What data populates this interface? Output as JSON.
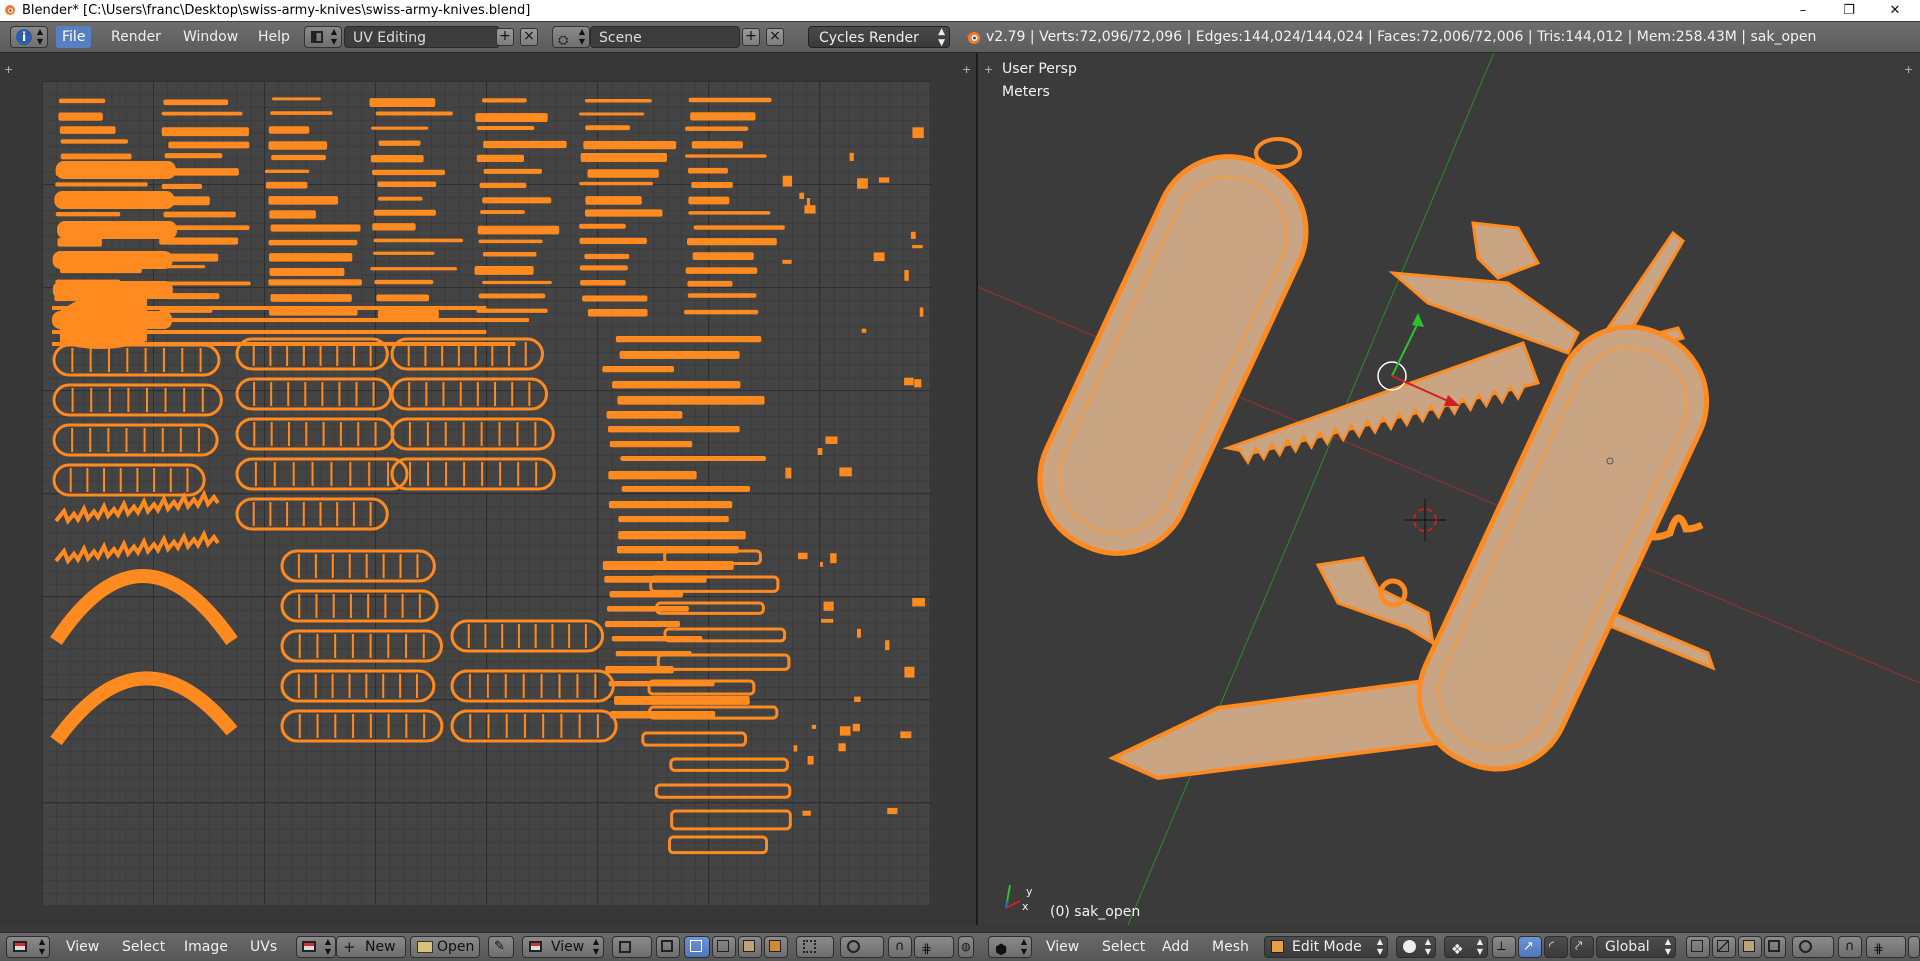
{
  "window": {
    "title": "Blender* [C:\\Users\\franc\\Desktop\\swiss-army-knives\\swiss-army-knives.blend]",
    "controls": [
      "–",
      "❐",
      "✕"
    ]
  },
  "header": {
    "menus": [
      "File",
      "Render",
      "Window",
      "Help"
    ],
    "screen_layout": "UV Editing",
    "scene": "Scene",
    "render_engine": "Cycles Render",
    "stats": "v2.79 | Verts:72,096/72,096 | Edges:144,024/144,024 | Faces:72,006/72,006 | Tris:144,012 | Mem:258.43M | sak_open"
  },
  "viewport": {
    "view_name": "User Persp",
    "units": "Meters",
    "object_label": "(0) sak_open",
    "axis_x": "x",
    "axis_y": "y"
  },
  "uv_footer": {
    "menus": [
      "View",
      "Select",
      "Image",
      "UVs"
    ],
    "new_label": "New",
    "open_label": "Open",
    "view_label": "View"
  },
  "view3d_footer": {
    "menus": [
      "View",
      "Select",
      "Add",
      "Mesh"
    ],
    "mode": "Edit Mode",
    "orientation": "Global"
  },
  "colors": {
    "selection": "#ff8a1f",
    "mesh_fill": "#c9a584",
    "accent": "#5680c2"
  }
}
